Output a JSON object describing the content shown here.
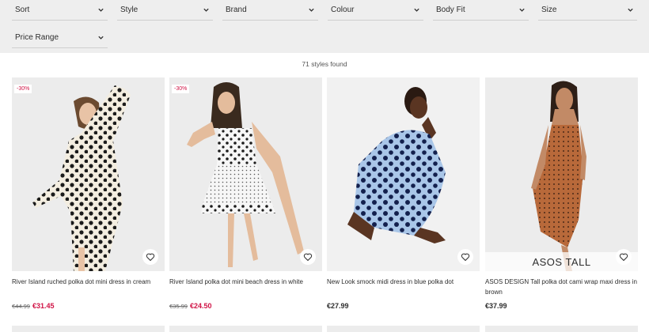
{
  "filters": [
    {
      "label": "Sort"
    },
    {
      "label": "Style"
    },
    {
      "label": "Brand"
    },
    {
      "label": "Colour"
    },
    {
      "label": "Body Fit"
    },
    {
      "label": "Size"
    },
    {
      "label": "Price Range"
    }
  ],
  "results_count": "71 styles found",
  "products": [
    {
      "title": "River Island ruched polka dot mini dress in cream",
      "old_price": "€44.99",
      "price": "€31.45",
      "badge": "-30%",
      "sale": true
    },
    {
      "title": "River Island polka dot mini beach dress in white",
      "old_price": "€35.99",
      "price": "€24.50",
      "badge": "-30%",
      "sale": true
    },
    {
      "title": "New Look smock midi dress in blue polka dot",
      "price": "€27.99",
      "sale": false
    },
    {
      "title": "ASOS DESIGN Tall polka dot cami wrap maxi dress in brown",
      "price": "€37.99",
      "sale": false,
      "overlay": "ASOS TALL"
    }
  ],
  "colors": {
    "filter_bg": "#eeeeee",
    "sale_red": "#d01345",
    "text": "#2d2d2d"
  }
}
